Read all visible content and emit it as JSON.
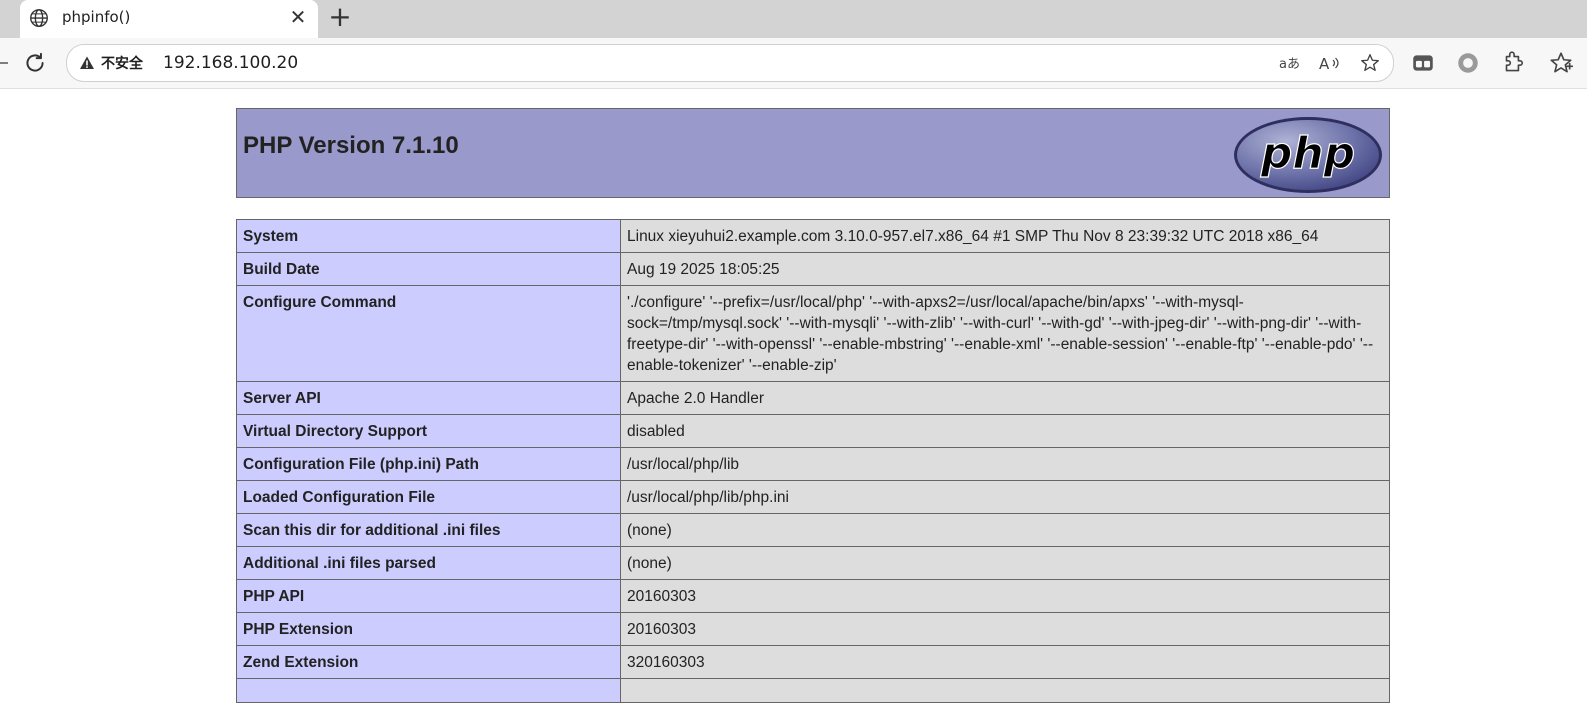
{
  "browser": {
    "tab": {
      "title": "phpinfo()",
      "icon": "globe-icon"
    },
    "new_tab_label": "+",
    "close_tab_label": "✕",
    "security_label": "不安全",
    "url": "192.168.100.20"
  },
  "page": {
    "heading": "PHP Version 7.1.10",
    "logo_text": "php",
    "colors": {
      "header_bg": "#9999cc",
      "key_bg": "#ccccff",
      "value_bg": "#dddddd"
    },
    "rows": [
      {
        "key": "System",
        "value": "Linux xieyuhui2.example.com 3.10.0-957.el7.x86_64 #1 SMP Thu Nov 8 23:39:32 UTC 2018 x86_64"
      },
      {
        "key": "Build Date",
        "value": "Aug 19 2025 18:05:25"
      },
      {
        "key": "Configure Command",
        "value": "'./configure' '--prefix=/usr/local/php' '--with-apxs2=/usr/local/apache/bin/apxs' '--with-mysql-sock=/tmp/mysql.sock' '--with-mysqli' '--with-zlib' '--with-curl' '--with-gd' '--with-jpeg-dir' '--with-png-dir' '--with-freetype-dir' '--with-openssl' '--enable-mbstring' '--enable-xml' '--enable-session' '--enable-ftp' '--enable-pdo' '--enable-tokenizer' '--enable-zip'"
      },
      {
        "key": "Server API",
        "value": "Apache 2.0 Handler"
      },
      {
        "key": "Virtual Directory Support",
        "value": "disabled"
      },
      {
        "key": "Configuration File (php.ini) Path",
        "value": "/usr/local/php/lib"
      },
      {
        "key": "Loaded Configuration File",
        "value": "/usr/local/php/lib/php.ini"
      },
      {
        "key": "Scan this dir for additional .ini files",
        "value": "(none)"
      },
      {
        "key": "Additional .ini files parsed",
        "value": "(none)"
      },
      {
        "key": "PHP API",
        "value": "20160303"
      },
      {
        "key": "PHP Extension",
        "value": "20160303"
      },
      {
        "key": "Zend Extension",
        "value": "320160303"
      },
      {
        "key": "",
        "value": ""
      }
    ]
  }
}
